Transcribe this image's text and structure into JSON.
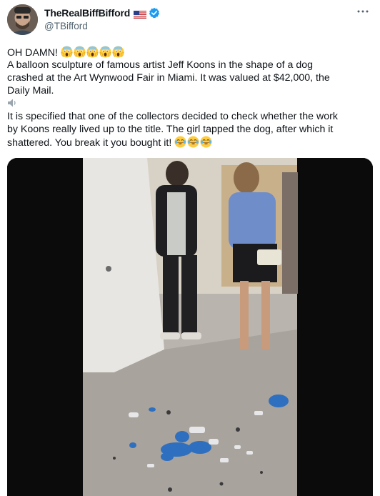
{
  "author": {
    "display_name": "TheRealBiffBifford",
    "handle": "@TBifford",
    "flag_icon": "us-flag-icon",
    "verified_icon": "verified-badge-icon",
    "verified_color": "#1d9bf0"
  },
  "tweet": {
    "line1": "OH DAMN!",
    "line1_emoji": [
      "scream-emoji",
      "scream-emoji",
      "scream-emoji",
      "scream-emoji",
      "scream-emoji"
    ],
    "para1": [
      "A balloon sculpture of famous artist Jeff Koons in the shape of a dog",
      "crashed at the Art Wynwood Fair in Miami. It was valued at $42,000, the",
      "Daily Mail."
    ],
    "para2": [
      "It is specified that one of the collectors decided to check whether the work",
      "by Koons really lived up to the title. The girl tapped the dog, after which it",
      "shattered. You break it you bought it!"
    ],
    "para2_emoji": [
      "joy-emoji",
      "joy-emoji",
      "joy-emoji"
    ]
  },
  "media": {
    "type": "video-still",
    "description_icon": "video-player"
  },
  "colors": {
    "text": "#0f1419",
    "secondary": "#536471",
    "verified": "#1d9bf0"
  }
}
